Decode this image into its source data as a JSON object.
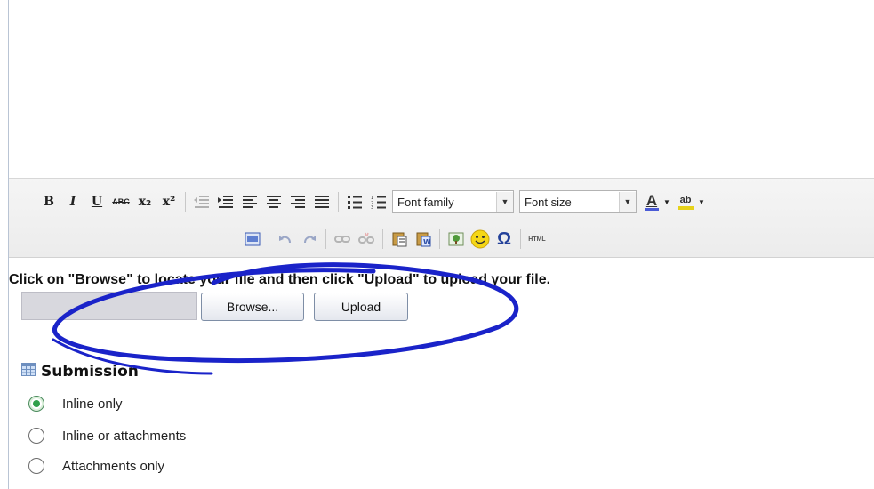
{
  "toolbar": {
    "row1_buttons": [
      {
        "name": "bold-button",
        "glyph": "B",
        "style": "fmt"
      },
      {
        "name": "italic-button",
        "glyph": "I",
        "style": "fmt-italic"
      },
      {
        "name": "underline-button",
        "glyph": "U",
        "style": "fmt-underline"
      },
      {
        "name": "strikethrough-button",
        "glyph": "ABC",
        "style": "small-strike"
      },
      {
        "name": "subscript-button",
        "glyph": "x₂",
        "style": "fmt"
      },
      {
        "name": "superscript-button",
        "glyph": "x²",
        "style": "fmt"
      }
    ],
    "font_family_label": "Font family",
    "font_size_label": "Font size",
    "text_color_glyph": "A",
    "highlight_glyph": "ab"
  },
  "upload": {
    "instruction": "Click on \"Browse\" to locate your file and then click \"Upload\" to upload your file.",
    "browse_label": "Browse...",
    "upload_label": "Upload"
  },
  "submission": {
    "title": "Submission",
    "options": [
      {
        "label": "Inline only",
        "checked": true
      },
      {
        "label": "Inline or attachments",
        "checked": false
      },
      {
        "label": "Attachments only",
        "checked": false
      }
    ]
  },
  "colors": {
    "annotation_stroke": "#1a23c9",
    "radio_checked": "#30a04a",
    "text_color_bar": "#4a5bd6",
    "highlight_bar": "#e6d21a"
  }
}
